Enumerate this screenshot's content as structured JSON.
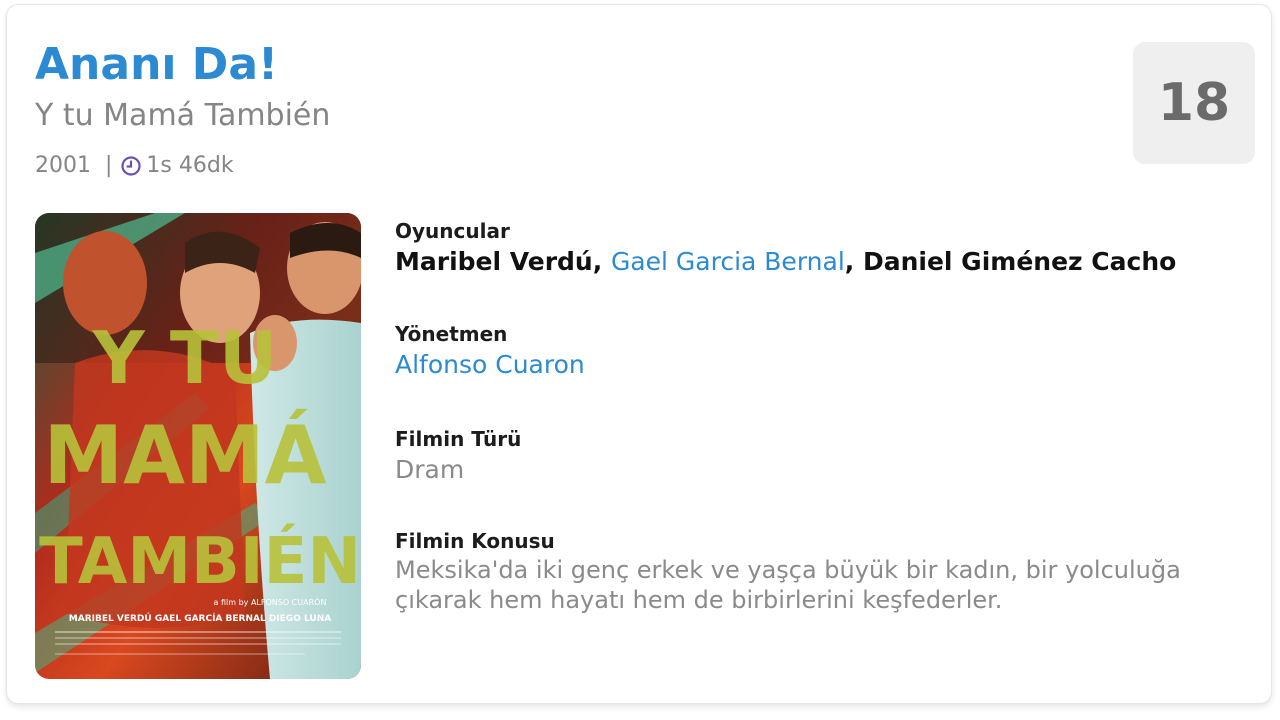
{
  "movie": {
    "title": "Ananı Da!",
    "original_title": "Y tu Mamá También",
    "year": "2001",
    "separator": "|",
    "duration": "1s 46dk",
    "age_rating": "18"
  },
  "poster": {
    "title_lines": [
      "Y TU",
      "MAMÁ",
      "TAMBIÉN"
    ],
    "director_credit": "a film by ALFONSO CUARÓN",
    "cast_credit": "MARIBEL VERDÚ   GAEL GARCÍA BERNAL   DIEGO LUNA"
  },
  "details": {
    "actors_label": "Oyuncular",
    "actors": [
      "Maribel Verdú",
      "Gael Garcia Bernal",
      "Daniel Giménez Cacho"
    ],
    "actor_separator": ", ",
    "director_label": "Yönetmen",
    "director": "Alfonso Cuaron",
    "genre_label": "Filmin Türü",
    "genre": "Dram",
    "plot_label": "Filmin Konusu",
    "plot": "Meksika'da iki genç erkek ve yaşça büyük bir kadın, bir yolculuğa çıkarak hem hayatı hem de birbirlerini keşfederler."
  },
  "icons": {
    "clock": "clock-icon"
  },
  "colors": {
    "accent": "#2b8ad1",
    "muted": "#858585",
    "clock": "#6a4fb5",
    "badge_bg": "#efefef"
  }
}
